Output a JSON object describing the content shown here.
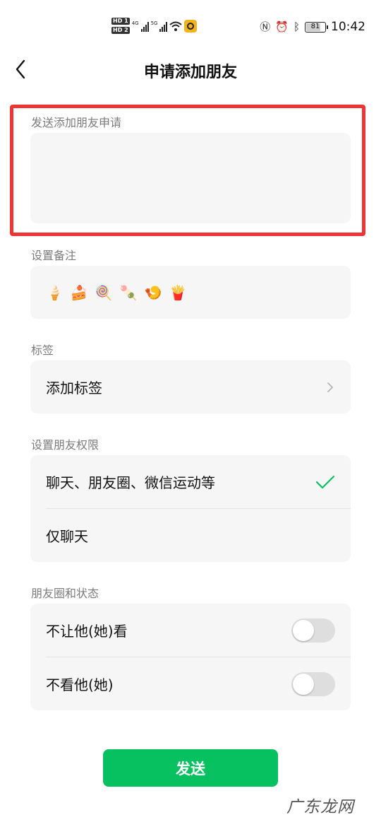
{
  "status_bar": {
    "hd1": "HD 1",
    "hd2": "HD 2",
    "net1": "4G",
    "net2": "5G",
    "battery": "81",
    "time": "10:42"
  },
  "nav": {
    "title": "申请添加朋友",
    "back_icon": "chevron-left-icon"
  },
  "request": {
    "label": "发送添加朋友申请",
    "value": "",
    "highlight_color": "#ee3434"
  },
  "remark": {
    "label": "设置备注",
    "emojis": [
      "🍦",
      "🍰",
      "🍭",
      "🍡",
      "🍤",
      "🍟"
    ]
  },
  "tags": {
    "label": "标签",
    "add_label": "添加标签"
  },
  "permissions": {
    "label": "设置朋友权限",
    "options": [
      {
        "label": "聊天、朋友圈、微信运动等",
        "selected": true
      },
      {
        "label": "仅聊天",
        "selected": false
      }
    ]
  },
  "moments": {
    "label": "朋友圈和状态",
    "options": [
      {
        "label": "不让他(她)看",
        "on": false
      },
      {
        "label": "不看他(她)",
        "on": false
      }
    ]
  },
  "send_button": "发送",
  "accent_color": "#07c160",
  "watermark": "广东龙网"
}
